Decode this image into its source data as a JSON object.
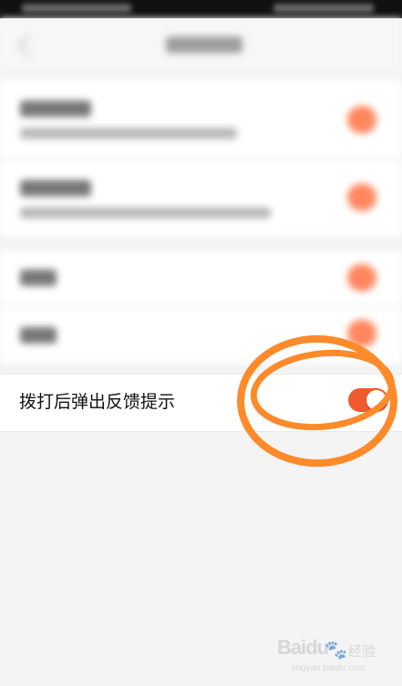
{
  "settings": {
    "feedback_row": {
      "label": "拨打后弹出反馈提示",
      "toggle_on": true,
      "toggle_color": "#f05a2c"
    }
  },
  "annotation": {
    "color": "#ff8a2a"
  },
  "watermark": {
    "brand": "Baidu",
    "suffix": "经验",
    "url": "jingyan.baidu.com"
  }
}
